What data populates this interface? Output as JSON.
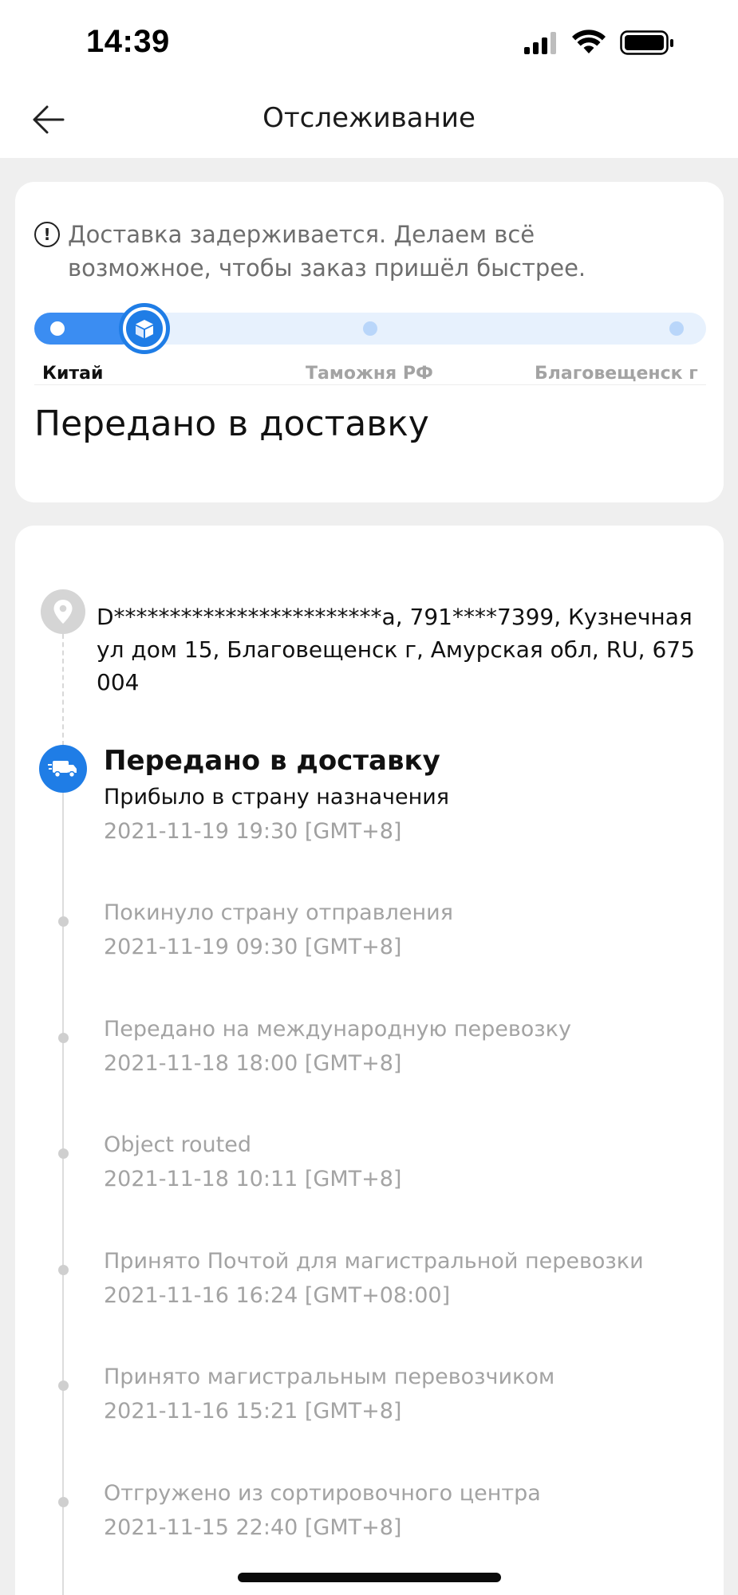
{
  "status_bar": {
    "time": "14:39",
    "icons": [
      "signal-icon",
      "wifi-icon",
      "battery-icon"
    ]
  },
  "header": {
    "title": "Отслеживание",
    "back_icon": "arrow-left-icon"
  },
  "status_card": {
    "notice_icon": "exclamation-circle-icon",
    "notice": "Доставка задерживается. Делаем всё возможное, чтобы заказ пришёл быстрее.",
    "stages": [
      "Китай",
      "Таможня РФ",
      "Благовещенск г"
    ],
    "active_stage_index": 0,
    "current_status": "Передано в доставку",
    "accent_color": "#1f7de6"
  },
  "timeline": {
    "address": "D************************а,  791****7399,  Кузнечная ул дом 15,  Благовещенск г,  Амурская обл,  RU,  675004",
    "current": {
      "title": "Передано в доставку",
      "description": "Прибыло в страну назначения",
      "time": "2021-11-19 19:30 [GMT+8]"
    },
    "events": [
      {
        "description": "Покинуло страну отправления",
        "time": "2021-11-19 09:30 [GMT+8]"
      },
      {
        "description": "Передано на международную перевозку",
        "time": "2021-11-18 18:00 [GMT+8]"
      },
      {
        "description": "Object routed",
        "time": "2021-11-18 10:11 [GMT+8]"
      },
      {
        "description": "Принято Почтой для магистральной перевозки",
        "time": "2021-11-16 16:24 [GMT+08:00]"
      },
      {
        "description": "Принято магистральным перевозчиком",
        "time": "2021-11-16 15:21 [GMT+8]"
      },
      {
        "description": "Отгружено из сортировочного центра",
        "time": "2021-11-15 22:40 [GMT+8]"
      }
    ]
  }
}
